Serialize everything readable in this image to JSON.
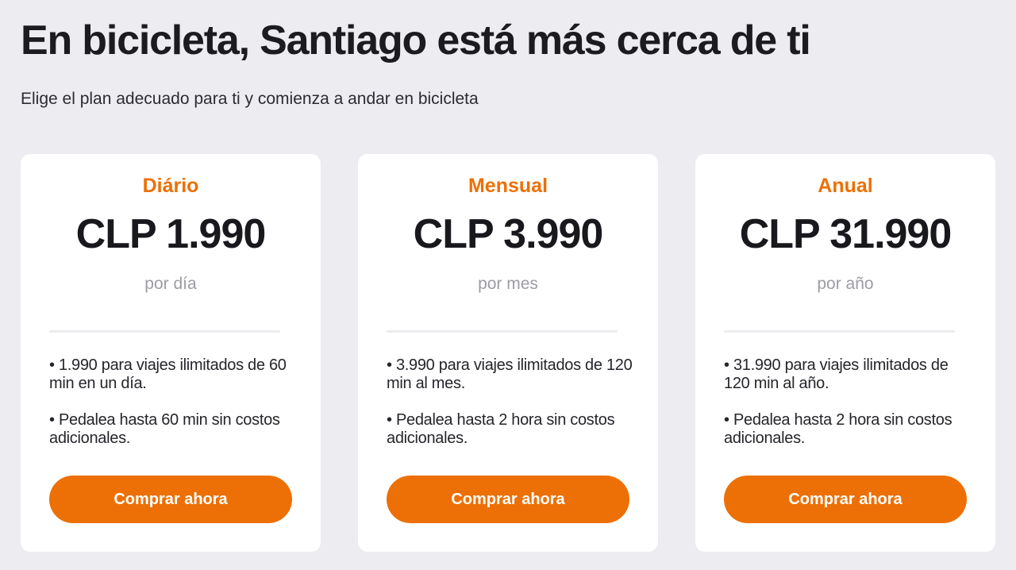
{
  "header": {
    "title": "En bicicleta, Santiago está más cerca de ti",
    "subtitle": "Elige el plan adecuado para ti y comienza a andar en bicicleta"
  },
  "colors": {
    "accent": "#ec7005",
    "background": "#ececf1",
    "card": "#ffffff",
    "text_dark": "#1f1f24",
    "text_muted": "#9c9ca4"
  },
  "plans": [
    {
      "name": "Diário",
      "price": "CLP 1.990",
      "period": "por día",
      "features": [
        "• 1.990 para viajes ilimitados de 60 min en un día.",
        "• Pedalea hasta 60 min sin costos adicionales."
      ],
      "button_label": "Comprar ahora"
    },
    {
      "name": "Mensual",
      "price": "CLP 3.990",
      "period": "por mes",
      "features": [
        "• 3.990 para viajes ilimitados de 120 min al mes.",
        "• Pedalea hasta 2 hora sin costos adicionales."
      ],
      "button_label": "Comprar ahora"
    },
    {
      "name": "Anual",
      "price": "CLP 31.990",
      "period": "por año",
      "features": [
        "• 31.990 para viajes ilimitados de 120 min al año.",
        "• Pedalea hasta 2 hora sin costos adicionales."
      ],
      "button_label": "Comprar ahora"
    }
  ]
}
